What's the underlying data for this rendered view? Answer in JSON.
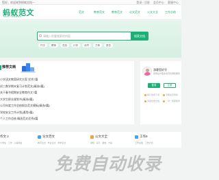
{
  "topbar": {
    "welcome": "您好，欢迎来到蚂蚁文档一",
    "links": [
      "登录 / 注册",
      "会员中心",
      "客服中心"
    ]
  },
  "header": {
    "logo": "蚂蚁范文",
    "logo_sub": "MAYI FANWEN",
    "nav": [
      "范文",
      "教育范文",
      "教育范文",
      "论文范文",
      "公文大全",
      "工作总结"
    ]
  },
  "search": {
    "placeholder": "请输入你要搜索的内容",
    "button": "搜索文档"
  },
  "hot_tags": [
    "作文",
    "教案",
    "总结",
    "计划",
    "合同",
    "方案",
    "报告"
  ],
  "main": {
    "section_title": "推荐文档",
    "docs": [
      "小学语文教案研究方案 优秀7篇",
      "初三数学期末复习计划范文(精选5篇)",
      "关于春节假期安全教育作文7篇",
      "大学生职业规划书(精选8篇)",
      "公司年度工作总结报告范文模板(精选8篇)",
      "学校安全工作计划(通用5篇)",
      "个人工作总结 精选范文优秀8篇"
    ]
  },
  "user": {
    "name": "游客您好号",
    "tip": "登录后享更多会员优惠和服务",
    "login": "登录",
    "register": "注册",
    "perks": [
      "每日免费下载",
      "专属会员特权",
      "海量优质文档",
      "一对一客服服务"
    ]
  },
  "categories": [
    {
      "title": "作文 2",
      "sub": "大学生 · 工作 · 心得体会",
      "color": "#1bb176"
    },
    {
      "title": "论文范文",
      "sub": "教育论文 · 毕业论文 · 学术论文",
      "color": "#4aa3e8"
    },
    {
      "title": "公文大全",
      "sub": "通知 · 请示 · 报告 · 方案",
      "color": "#f2a341"
    },
    {
      "title": "工作9",
      "sub": "工作总结 · 工作计划",
      "color": "#4aa3e8"
    }
  ],
  "watermark": "免费自动收录",
  "colors": {
    "accent": "#1bb176",
    "hero": "#dff3e9"
  }
}
